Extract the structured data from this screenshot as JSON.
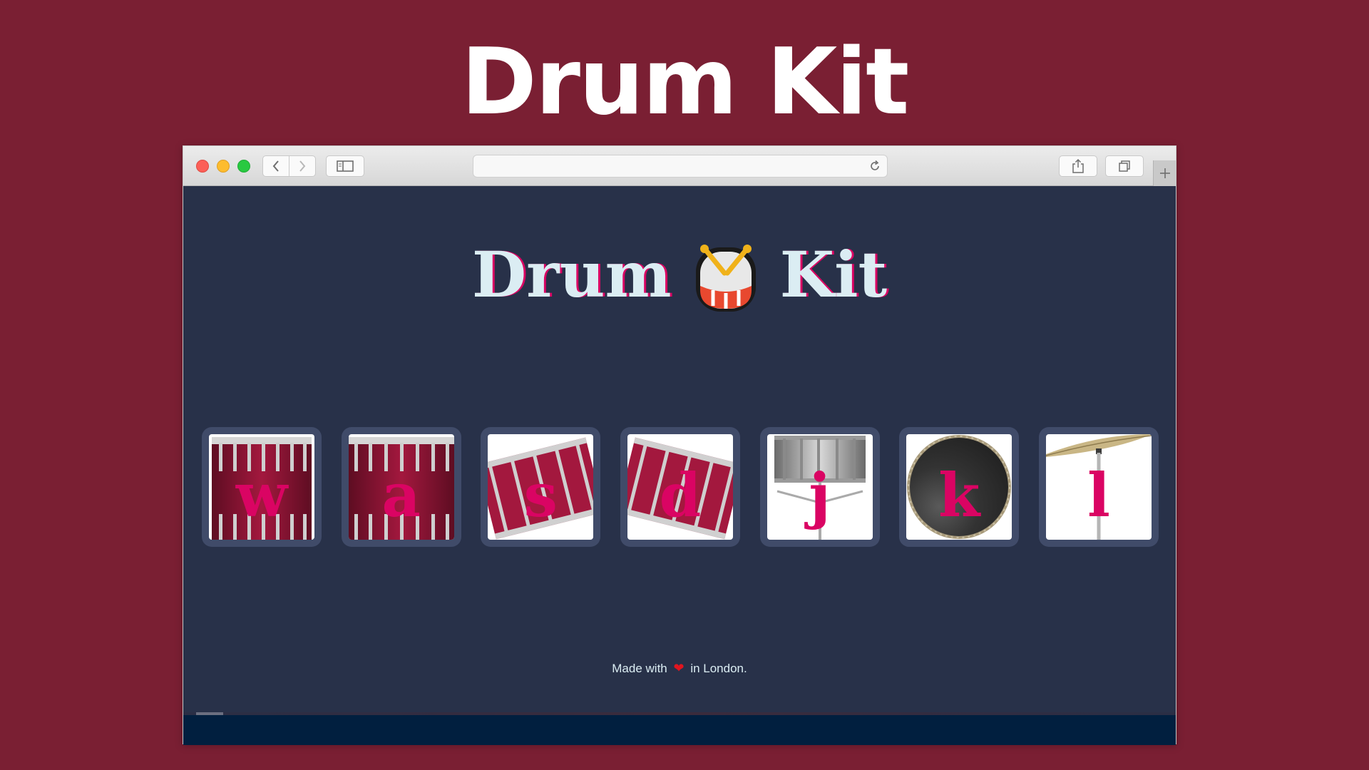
{
  "hero": {
    "title": "Drum Kit"
  },
  "browser": {
    "address": "",
    "icons": {
      "back": "chevron-left-icon",
      "forward": "chevron-right-icon",
      "sidebar": "sidebar-icon",
      "reload": "reload-icon",
      "share": "share-icon",
      "tabs": "tabs-icon",
      "new_tab": "plus-icon"
    }
  },
  "page": {
    "title_left": "Drum",
    "title_emoji": "drum-emoji-icon",
    "title_right": "Kit",
    "drums": [
      {
        "key": "w",
        "instrument": "tom-1"
      },
      {
        "key": "a",
        "instrument": "tom-2"
      },
      {
        "key": "s",
        "instrument": "tom-3"
      },
      {
        "key": "d",
        "instrument": "tom-4"
      },
      {
        "key": "j",
        "instrument": "snare"
      },
      {
        "key": "k",
        "instrument": "kick-bass"
      },
      {
        "key": "l",
        "instrument": "crash"
      }
    ],
    "footer": {
      "before": "Made with",
      "after": "in London."
    }
  },
  "colors": {
    "background": "#7a1f33",
    "page_bg": "#283149",
    "tile_bg": "#404b69",
    "key_color": "#da0463",
    "title_color": "#dbedf3"
  }
}
